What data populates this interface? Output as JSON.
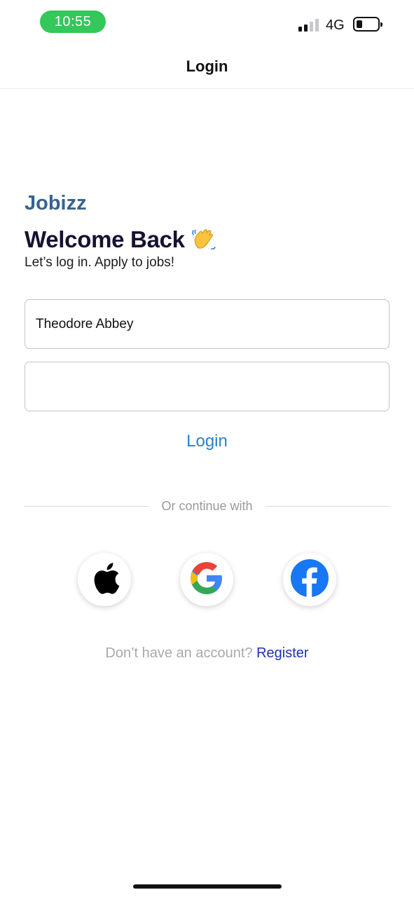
{
  "status_bar": {
    "time": "10:55",
    "network": "4G",
    "signal_icon": "cellular-signal-icon",
    "battery_icon": "battery-icon",
    "battery_level": 0.2,
    "time_pill_color": "#34c759"
  },
  "header": {
    "title": "Login"
  },
  "brand": {
    "name": "Jobizz",
    "color": "#356390"
  },
  "welcome": {
    "title": "Welcome Back",
    "emoji_icon": "waving-hand-icon",
    "subtitle": "Let’s log in. Apply to jobs!"
  },
  "form": {
    "username_value": "Theodore Abbey",
    "password_value": "",
    "login_label": "Login",
    "login_color": "#2a82c9"
  },
  "divider": {
    "label": "Or continue with"
  },
  "social": {
    "buttons": [
      {
        "icon": "apple-icon"
      },
      {
        "icon": "google-icon"
      },
      {
        "icon": "facebook-icon"
      }
    ]
  },
  "register": {
    "prompt": "Don’t have an account?",
    "link_label": "Register",
    "link_color": "#1f2fb3"
  }
}
